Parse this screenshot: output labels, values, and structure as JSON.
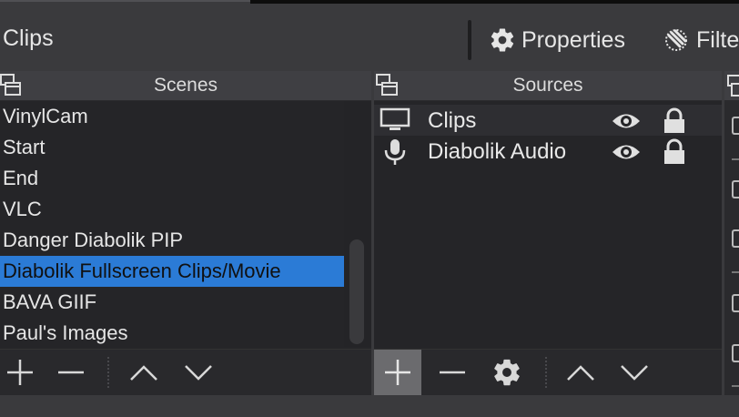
{
  "toolbar": {
    "current_scene": "Clips",
    "properties_label": "Properties",
    "filters_label": "Filte",
    "properties_icon": "gear-icon",
    "filters_icon": "filters-icon"
  },
  "scenes": {
    "header": "Scenes",
    "items": [
      {
        "label": "VinylCam",
        "selected": false
      },
      {
        "label": "Start",
        "selected": false
      },
      {
        "label": "End",
        "selected": false
      },
      {
        "label": "VLC",
        "selected": false
      },
      {
        "label": "Danger Diabolik PIP",
        "selected": false
      },
      {
        "label": "Diabolik Fullscreen Clips/Movie",
        "selected": true
      },
      {
        "label": "BAVA GIIF",
        "selected": false
      },
      {
        "label": "Paul's Images",
        "selected": false
      }
    ],
    "footer_buttons": [
      "add-icon",
      "remove-icon",
      "move-up-icon",
      "move-down-icon"
    ]
  },
  "sources": {
    "header": "Sources",
    "items": [
      {
        "label": "Clips",
        "icon": "display-icon",
        "visible": true,
        "locked": true
      },
      {
        "label": "Diabolik Audio",
        "icon": "microphone-icon",
        "visible": true,
        "locked": true
      }
    ],
    "footer_buttons": [
      "add-icon",
      "remove-icon",
      "gear-icon",
      "move-up-icon",
      "move-down-icon"
    ]
  },
  "colors": {
    "selection": "#2b7bd6",
    "panel_bg": "#252528",
    "header_bg": "#3f3f43",
    "window_bg": "#3a3a3d"
  }
}
